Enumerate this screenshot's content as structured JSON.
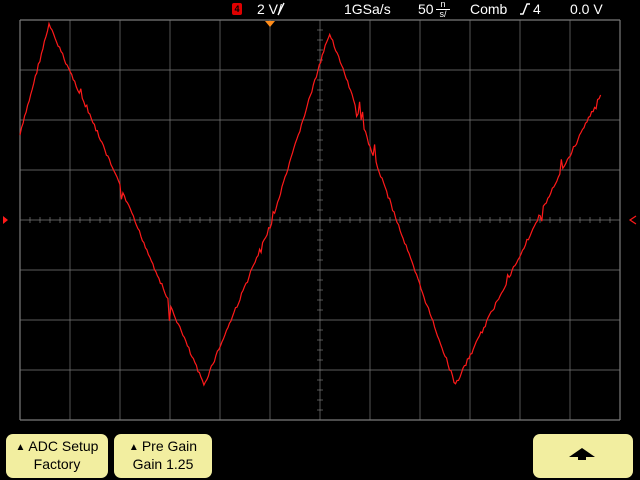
{
  "header": {
    "channel_number": "4",
    "channel_scale": "2 V/",
    "sample_rate": "1GSa/s",
    "timebase_value": "50",
    "timebase_unit_top": "n",
    "timebase_unit_bottom": "s/",
    "acquisition_mode": "Comb",
    "trigger_source": "4",
    "trigger_level": "0.0 V"
  },
  "softkeys": {
    "adc_setup": {
      "line1": "ADC Setup",
      "line2": "Factory"
    },
    "pre_gain": {
      "line1": "Pre Gain",
      "line2": "Gain 1.25"
    },
    "up": {
      "icon": "up-arrow-icon"
    }
  },
  "colors": {
    "background": "#000000",
    "grid": "#7a7a7a",
    "trace": "#ff1a1a",
    "softkey": "#f2eea0",
    "trigger_marker": "#ff8c1a"
  },
  "chart_data": {
    "type": "line",
    "series": [
      {
        "name": "",
        "description_points": [
          {
            "t_ns": 0,
            "v": 3.4
          },
          {
            "t_ns": 15,
            "v": 7.8
          },
          {
            "t_ns": 40,
            "v": 3.5
          },
          {
            "t_ns": 95,
            "v": -6.6
          },
          {
            "t_ns": 130,
            "v": -0.1
          },
          {
            "t_ns": 160,
            "v": 7.5
          },
          {
            "t_ns": 225,
            "v": -6.6
          },
          {
            "t_ns": 275,
            "v": 1.2
          },
          {
            "t_ns": 300,
            "v": 5.0
          }
        ]
      }
    ],
    "x_range_ns": [
      0,
      310
    ],
    "y_range_V": [
      -8,
      8
    ],
    "grid": true
  }
}
